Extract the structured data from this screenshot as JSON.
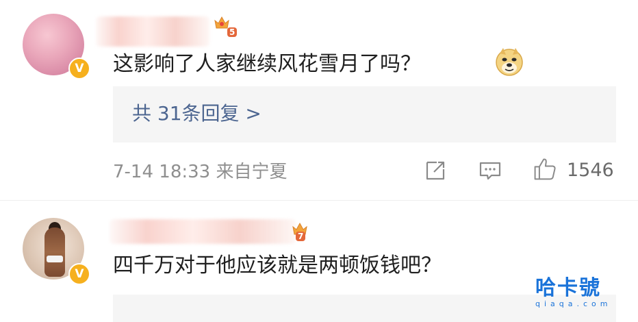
{
  "comments": [
    {
      "avatar_icon": "pink-sky-avatar",
      "verified_badge": "V",
      "level_badge": "5",
      "text": "这影响了人家继续风花雪月了吗？",
      "emoji_icon": "doge-emoji",
      "replies_label": "共 31条回复 >",
      "meta": "7-14 18:33  来自宁夏",
      "like_count": "1546"
    },
    {
      "avatar_icon": "muscle-man-avatar",
      "verified_badge": "V",
      "level_badge": "7",
      "text": "四千万对于他应该就是两顿饭钱吧？"
    }
  ],
  "watermark": {
    "main": "哈卡號",
    "sub": "qiaqa.com"
  },
  "colors": {
    "reply_link": "#4c6590",
    "badge_gold": "#f6b01e",
    "meta_gray": "#8f8f8f",
    "reply_bg": "#f5f5f5",
    "watermark_blue": "#1a73d9"
  }
}
